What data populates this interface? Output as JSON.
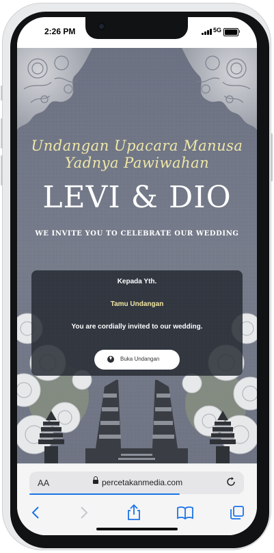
{
  "status_bar": {
    "time": "2:26 PM",
    "network": "5G"
  },
  "invitation": {
    "script_line1": "Undangan Upacara Manusa",
    "script_line2": "Yadnya Pawiwahan",
    "couple": "LEVI & DIO",
    "tagline": "WE INVITE YOU TO CELEBRATE OUR WEDDING",
    "card": {
      "greeting": "Kepada Yth.",
      "guest": "Tamu Undangan",
      "message": "You are cordially invited to our wedding.",
      "open_button": "Buka Undangan"
    }
  },
  "browser": {
    "text_size_label": "AA",
    "address": "percetakanmedia.com",
    "icons": [
      "back-icon",
      "forward-icon",
      "share-icon",
      "bookmarks-icon",
      "tabs-icon",
      "reload-icon",
      "lock-icon"
    ]
  },
  "colors": {
    "background": "#71778a",
    "script": "#efe7a8",
    "card": "#2a2e36",
    "accent": "#1a73e8"
  }
}
